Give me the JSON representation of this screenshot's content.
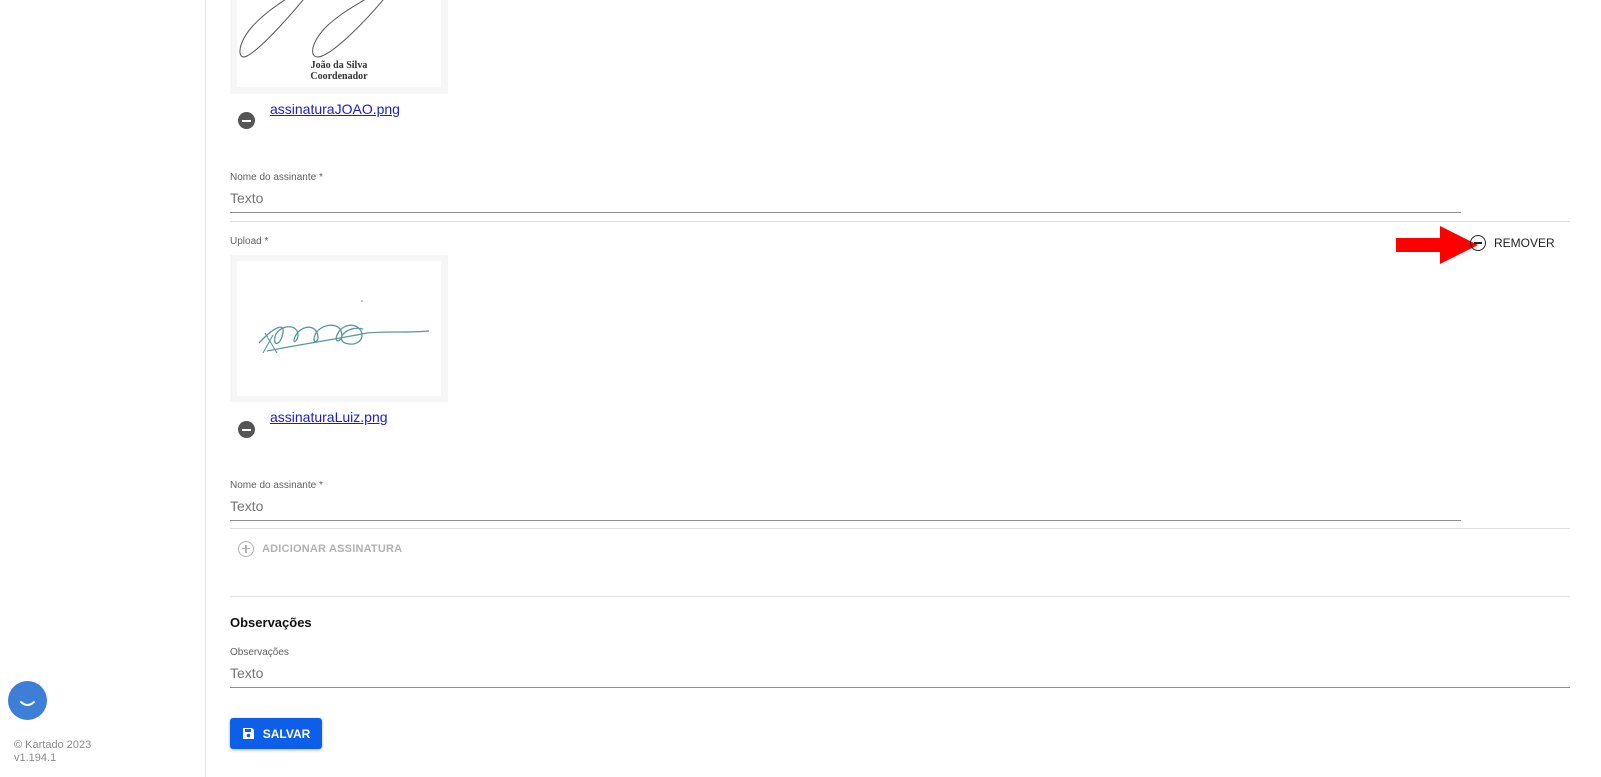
{
  "footer": {
    "copyright": "© Kartado 2023",
    "version": "v1.194.1"
  },
  "signatures": [
    {
      "image_name": "João da Silva",
      "image_role": "Coordenador",
      "file_name": "assinaturaJOAO.png",
      "name_label": "Nome do assinante *",
      "name_placeholder": "Texto"
    },
    {
      "upload_label": "Upload *",
      "remove_label": "REMOVER",
      "file_name": "assinaturaLuiz.png",
      "name_label": "Nome do assinante *",
      "name_placeholder": "Texto"
    }
  ],
  "add_signature_label": "ADICIONAR ASSINATURA",
  "observations": {
    "section_title": "Observações",
    "label": "Observações",
    "placeholder": "Texto"
  },
  "save_label": "SALVAR",
  "colors": {
    "primary": "#0d5fe8",
    "annotation_arrow": "#ff0000",
    "link": "#1a1adb",
    "chat": "#3d7fd6"
  }
}
